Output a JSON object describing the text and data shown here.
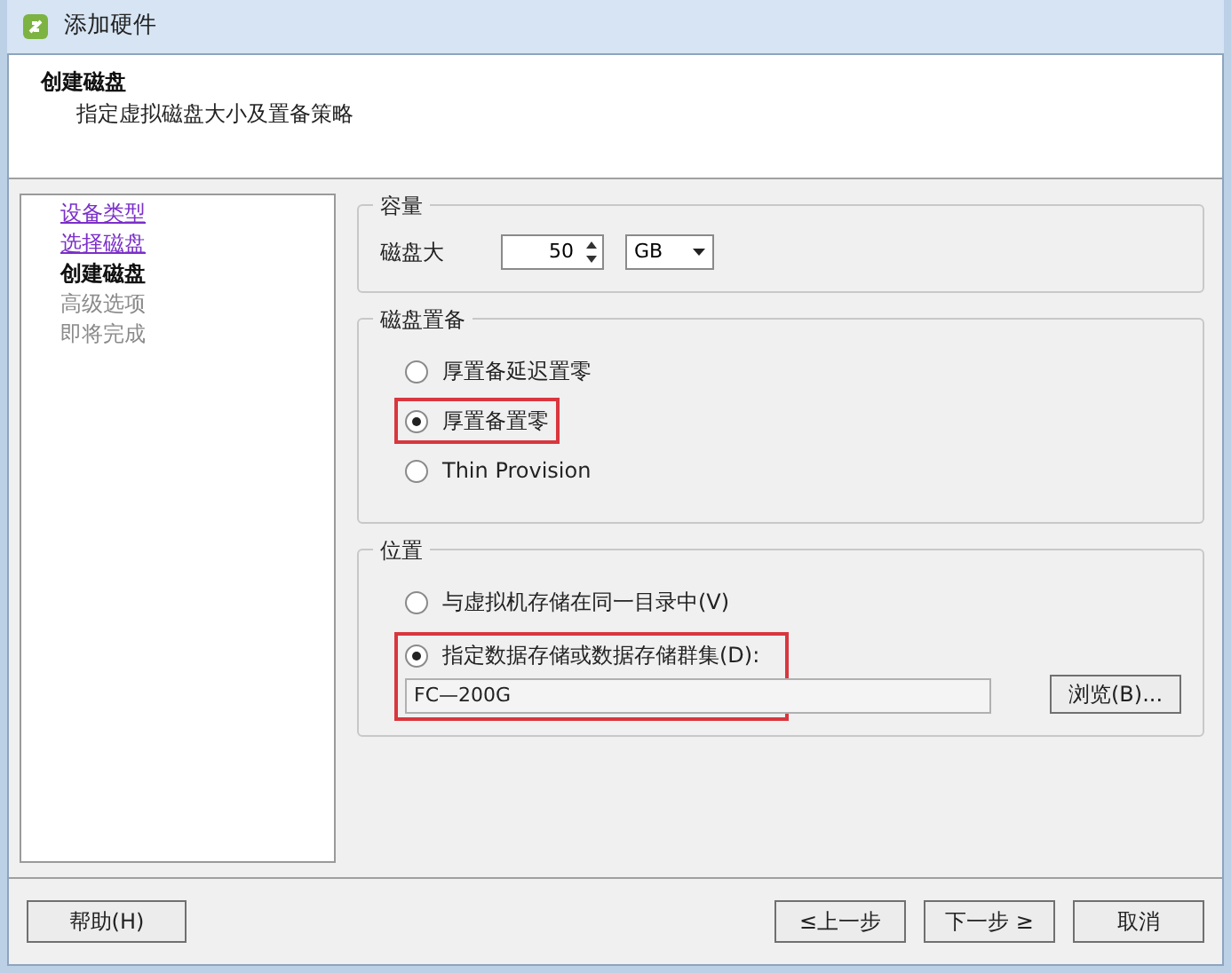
{
  "window": {
    "title": "添加硬件"
  },
  "header": {
    "title": "创建磁盘",
    "subtitle": "指定虚拟磁盘大小及置备策略"
  },
  "steps": [
    {
      "label": "设备类型",
      "kind": "link"
    },
    {
      "label": "选择磁盘",
      "kind": "link"
    },
    {
      "label": "创建磁盘",
      "kind": "current"
    },
    {
      "label": "高级选项",
      "kind": "pending"
    },
    {
      "label": "即将完成",
      "kind": "pending"
    }
  ],
  "capacity": {
    "title": "容量",
    "label": "磁盘大",
    "value": "50",
    "unit": "GB"
  },
  "provisioning": {
    "title": "磁盘置备",
    "options": [
      {
        "label": "厚置备延迟置零",
        "selected": false,
        "highlighted": false
      },
      {
        "label": "厚置备置零",
        "selected": true,
        "highlighted": true
      },
      {
        "label": "Thin Provision",
        "selected": false,
        "highlighted": false
      }
    ]
  },
  "location": {
    "title": "位置",
    "options": [
      {
        "label": "与虚拟机存储在同一目录中(V)",
        "selected": false,
        "highlighted": false
      },
      {
        "label": "指定数据存储或数据存储群集(D):",
        "selected": true,
        "highlighted": true
      }
    ],
    "datastore": "FC—200G",
    "browse_button": "浏览(B)..."
  },
  "footer": {
    "help_button": "帮助(H)",
    "back_button": "≤上一步",
    "next_button": "下一步 ≥",
    "cancel_button": "取消"
  }
}
